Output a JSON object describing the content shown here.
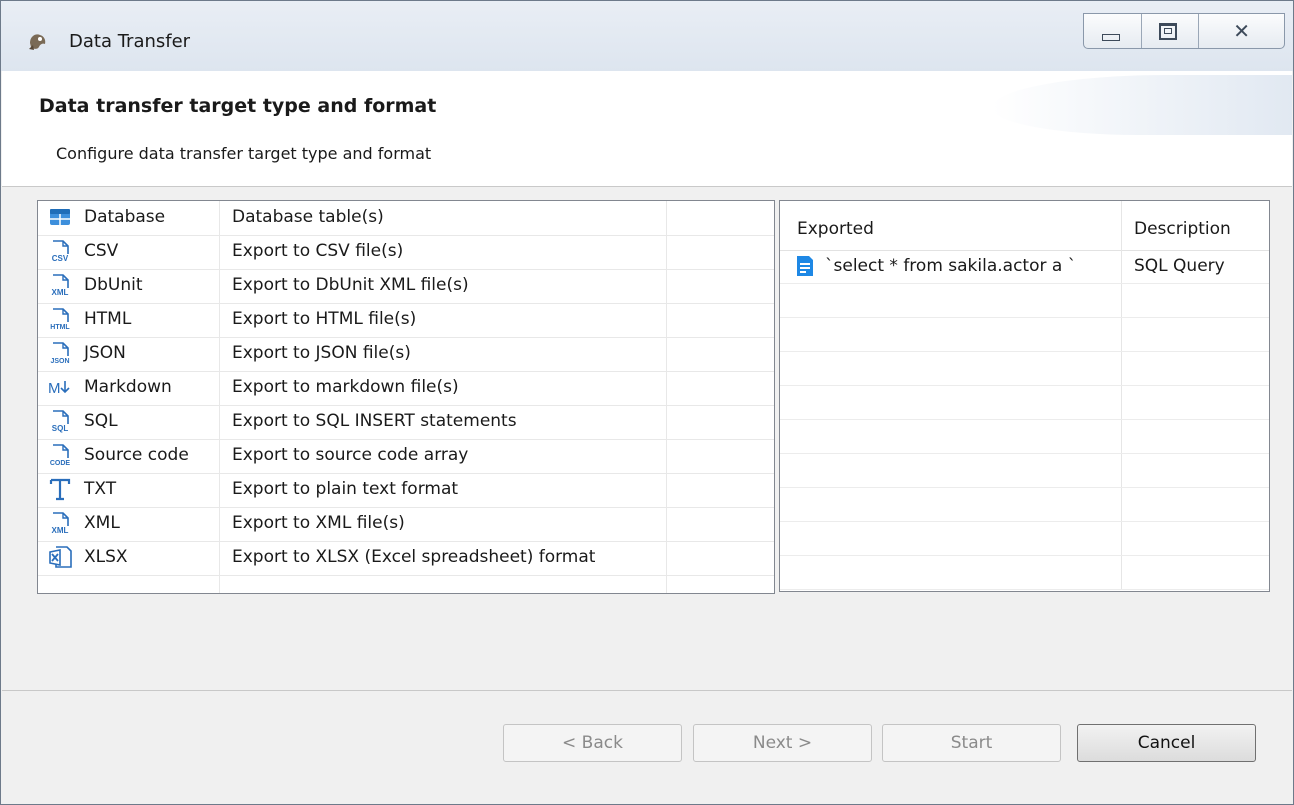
{
  "window": {
    "title": "Data Transfer"
  },
  "header": {
    "title": "Data transfer target type and format",
    "description": "Configure data transfer target type and format"
  },
  "formats": [
    {
      "name": "Database",
      "description": "Database table(s)",
      "icon": "database-icon"
    },
    {
      "name": "CSV",
      "description": "Export to CSV file(s)",
      "icon": "csv-file-icon"
    },
    {
      "name": "DbUnit",
      "description": "Export to DbUnit XML file(s)",
      "icon": "xml-file-icon"
    },
    {
      "name": "HTML",
      "description": "Export to HTML file(s)",
      "icon": "html-file-icon"
    },
    {
      "name": "JSON",
      "description": "Export to JSON file(s)",
      "icon": "json-file-icon"
    },
    {
      "name": "Markdown",
      "description": "Export to markdown file(s)",
      "icon": "markdown-icon"
    },
    {
      "name": "SQL",
      "description": "Export to SQL INSERT statements",
      "icon": "sql-file-icon"
    },
    {
      "name": "Source code",
      "description": "Export to source code array",
      "icon": "code-file-icon"
    },
    {
      "name": "TXT",
      "description": "Export to plain text format",
      "icon": "text-icon"
    },
    {
      "name": "XML",
      "description": "Export to XML file(s)",
      "icon": "xml-file-icon"
    },
    {
      "name": "XLSX",
      "description": "Export to XLSX (Excel spreadsheet) format",
      "icon": "excel-icon"
    }
  ],
  "exported": {
    "headers": {
      "exported": "Exported",
      "description": "Description"
    },
    "rows": [
      {
        "query": "`select * from sakila.actor a `",
        "description": "SQL Query",
        "icon": "sql-script-icon"
      }
    ]
  },
  "buttons": {
    "back": "< Back",
    "next": "Next >",
    "start": "Start",
    "cancel": "Cancel"
  },
  "colors": {
    "icon_blue": "#2a6ebb",
    "query_icon": "#1e88e5"
  }
}
